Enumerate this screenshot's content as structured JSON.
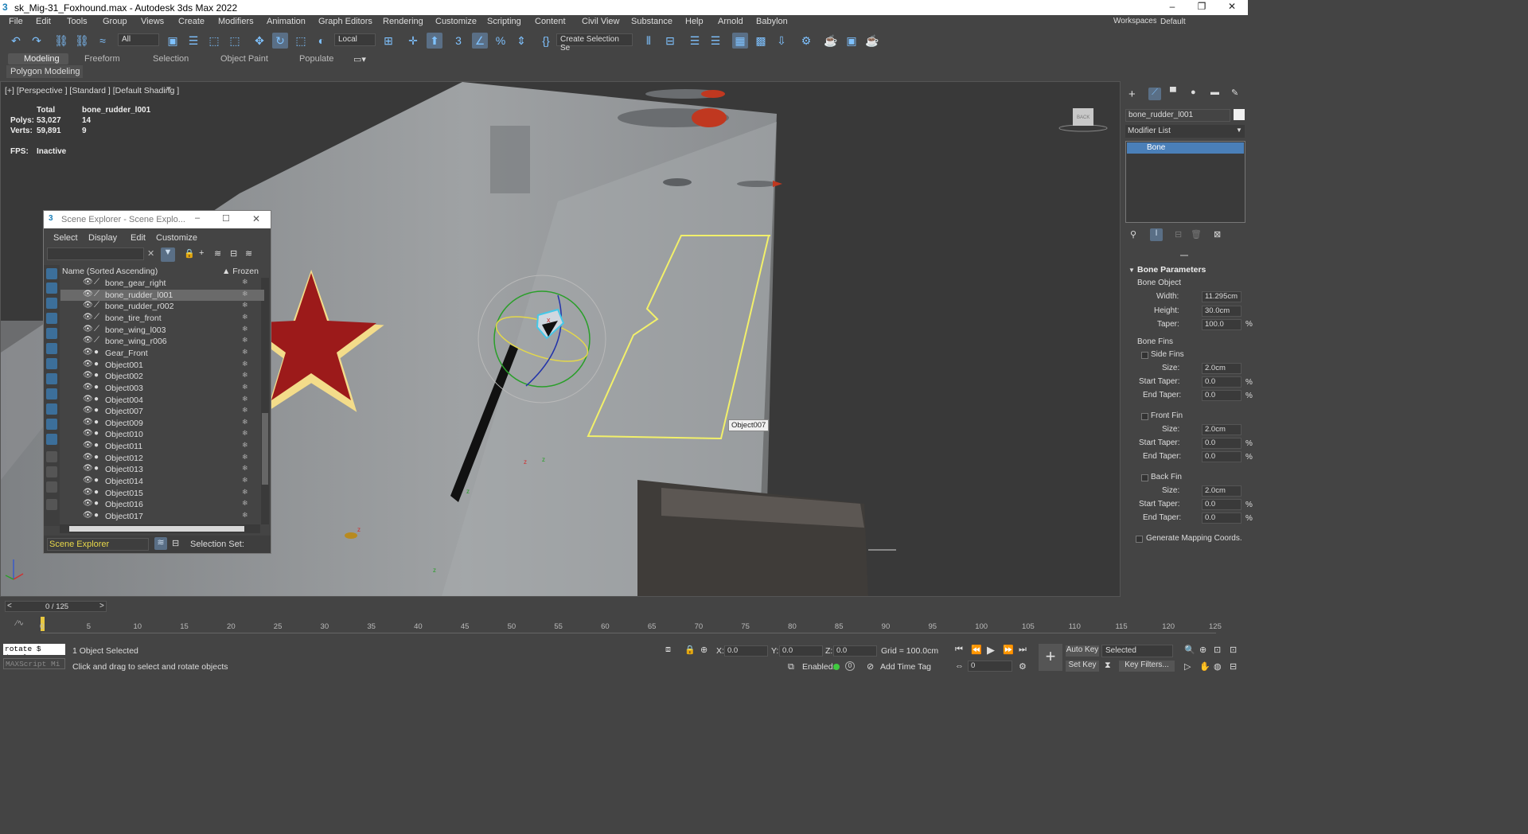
{
  "title": "sk_Mig-31_Foxhound.max - Autodesk 3ds Max 2022",
  "menu": [
    "File",
    "Edit",
    "Tools",
    "Group",
    "Views",
    "Create",
    "Modifiers",
    "Animation",
    "Graph Editors",
    "Rendering",
    "Customize",
    "Scripting",
    "Content",
    "Civil View",
    "Substance",
    "Help",
    "Arnold",
    "Babylon"
  ],
  "workspace": {
    "label": "Workspaces:",
    "value": "Default"
  },
  "toolbar": {
    "filter": "All",
    "coord": "Local",
    "selection_set": "Create Selection Se"
  },
  "ribbon": {
    "tabs": [
      "Modeling",
      "Freeform",
      "Selection",
      "Object Paint",
      "Populate"
    ],
    "sub": "Polygon Modeling"
  },
  "viewport": {
    "label": "[+] [Perspective ] [Standard ] [Default Shading ]",
    "stats": {
      "total": "Total",
      "obj": "bone_rudder_l001",
      "polys_l": "Polys:",
      "polys_t": "53,027",
      "polys_o": "14",
      "verts_l": "Verts:",
      "verts_t": "59,891",
      "verts_o": "9",
      "fps_l": "FPS:",
      "fps_v": "Inactive"
    },
    "tooltip": "Object007",
    "viewcube": "BACK"
  },
  "scene_explorer": {
    "title": "Scene Explorer - Scene Explo...",
    "menu": [
      "Select",
      "Display",
      "Edit",
      "Customize"
    ],
    "col_name": "Name (Sorted Ascending)",
    "col_frozen": "▲ Frozen",
    "rows": [
      "bone_gear_right",
      "bone_rudder_l001",
      "bone_rudder_r002",
      "bone_tire_front",
      "bone_wing_l003",
      "bone_wing_r006",
      "Gear_Front",
      "Object001",
      "Object002",
      "Object003",
      "Object004",
      "Object007",
      "Object009",
      "Object010",
      "Object011",
      "Object012",
      "Object013",
      "Object014",
      "Object015",
      "Object016",
      "Object017"
    ],
    "selected_row": "bone_rudder_l001",
    "footer_combo": "Scene Explorer",
    "footer_label": "Selection Set:"
  },
  "cmd": {
    "object_name": "bone_rudder_l001",
    "modifier_list": "Modifier List",
    "stack_item": "Bone",
    "rollout": "Bone Parameters",
    "bone_object": "Bone Object",
    "width_l": "Width:",
    "width_v": "11.295cm",
    "height_l": "Height:",
    "height_v": "30.0cm",
    "taper_l": "Taper:",
    "taper_v": "100.0",
    "pct": "%",
    "fins": "Bone Fins",
    "side_fins": "Side Fins",
    "front_fin": "Front Fin",
    "back_fin": "Back Fin",
    "size_l": "Size:",
    "size_v": "2.0cm",
    "st_l": "Start Taper:",
    "et_l": "End Taper:",
    "tv": "0.0",
    "gen": "Generate Mapping Coords."
  },
  "timeline": {
    "frame": "0 / 125",
    "ticks": [
      "0",
      "5",
      "10",
      "15",
      "20",
      "25",
      "30",
      "35",
      "40",
      "45",
      "50",
      "55",
      "60",
      "65",
      "70",
      "75",
      "80",
      "85",
      "90",
      "95",
      "100",
      "105",
      "110",
      "115",
      "120",
      "125"
    ]
  },
  "status": {
    "script": "rotate $ (angl",
    "mini": "MAXScript Mi",
    "selected": "1 Object Selected",
    "prompt": "Click and drag to select and rotate objects",
    "x_l": "X:",
    "x_v": "0.0",
    "y_l": "Y:",
    "y_v": "0.0",
    "z_l": "Z:",
    "z_v": "0.0",
    "grid": "Grid = 100.0cm",
    "enabled": "Enabled:",
    "addtag": "Add Time Tag",
    "autokey": "Auto Key",
    "setkey": "Set Key",
    "selected_dd": "Selected",
    "keyfilters": "Key Filters...",
    "frame_spin": "0"
  }
}
